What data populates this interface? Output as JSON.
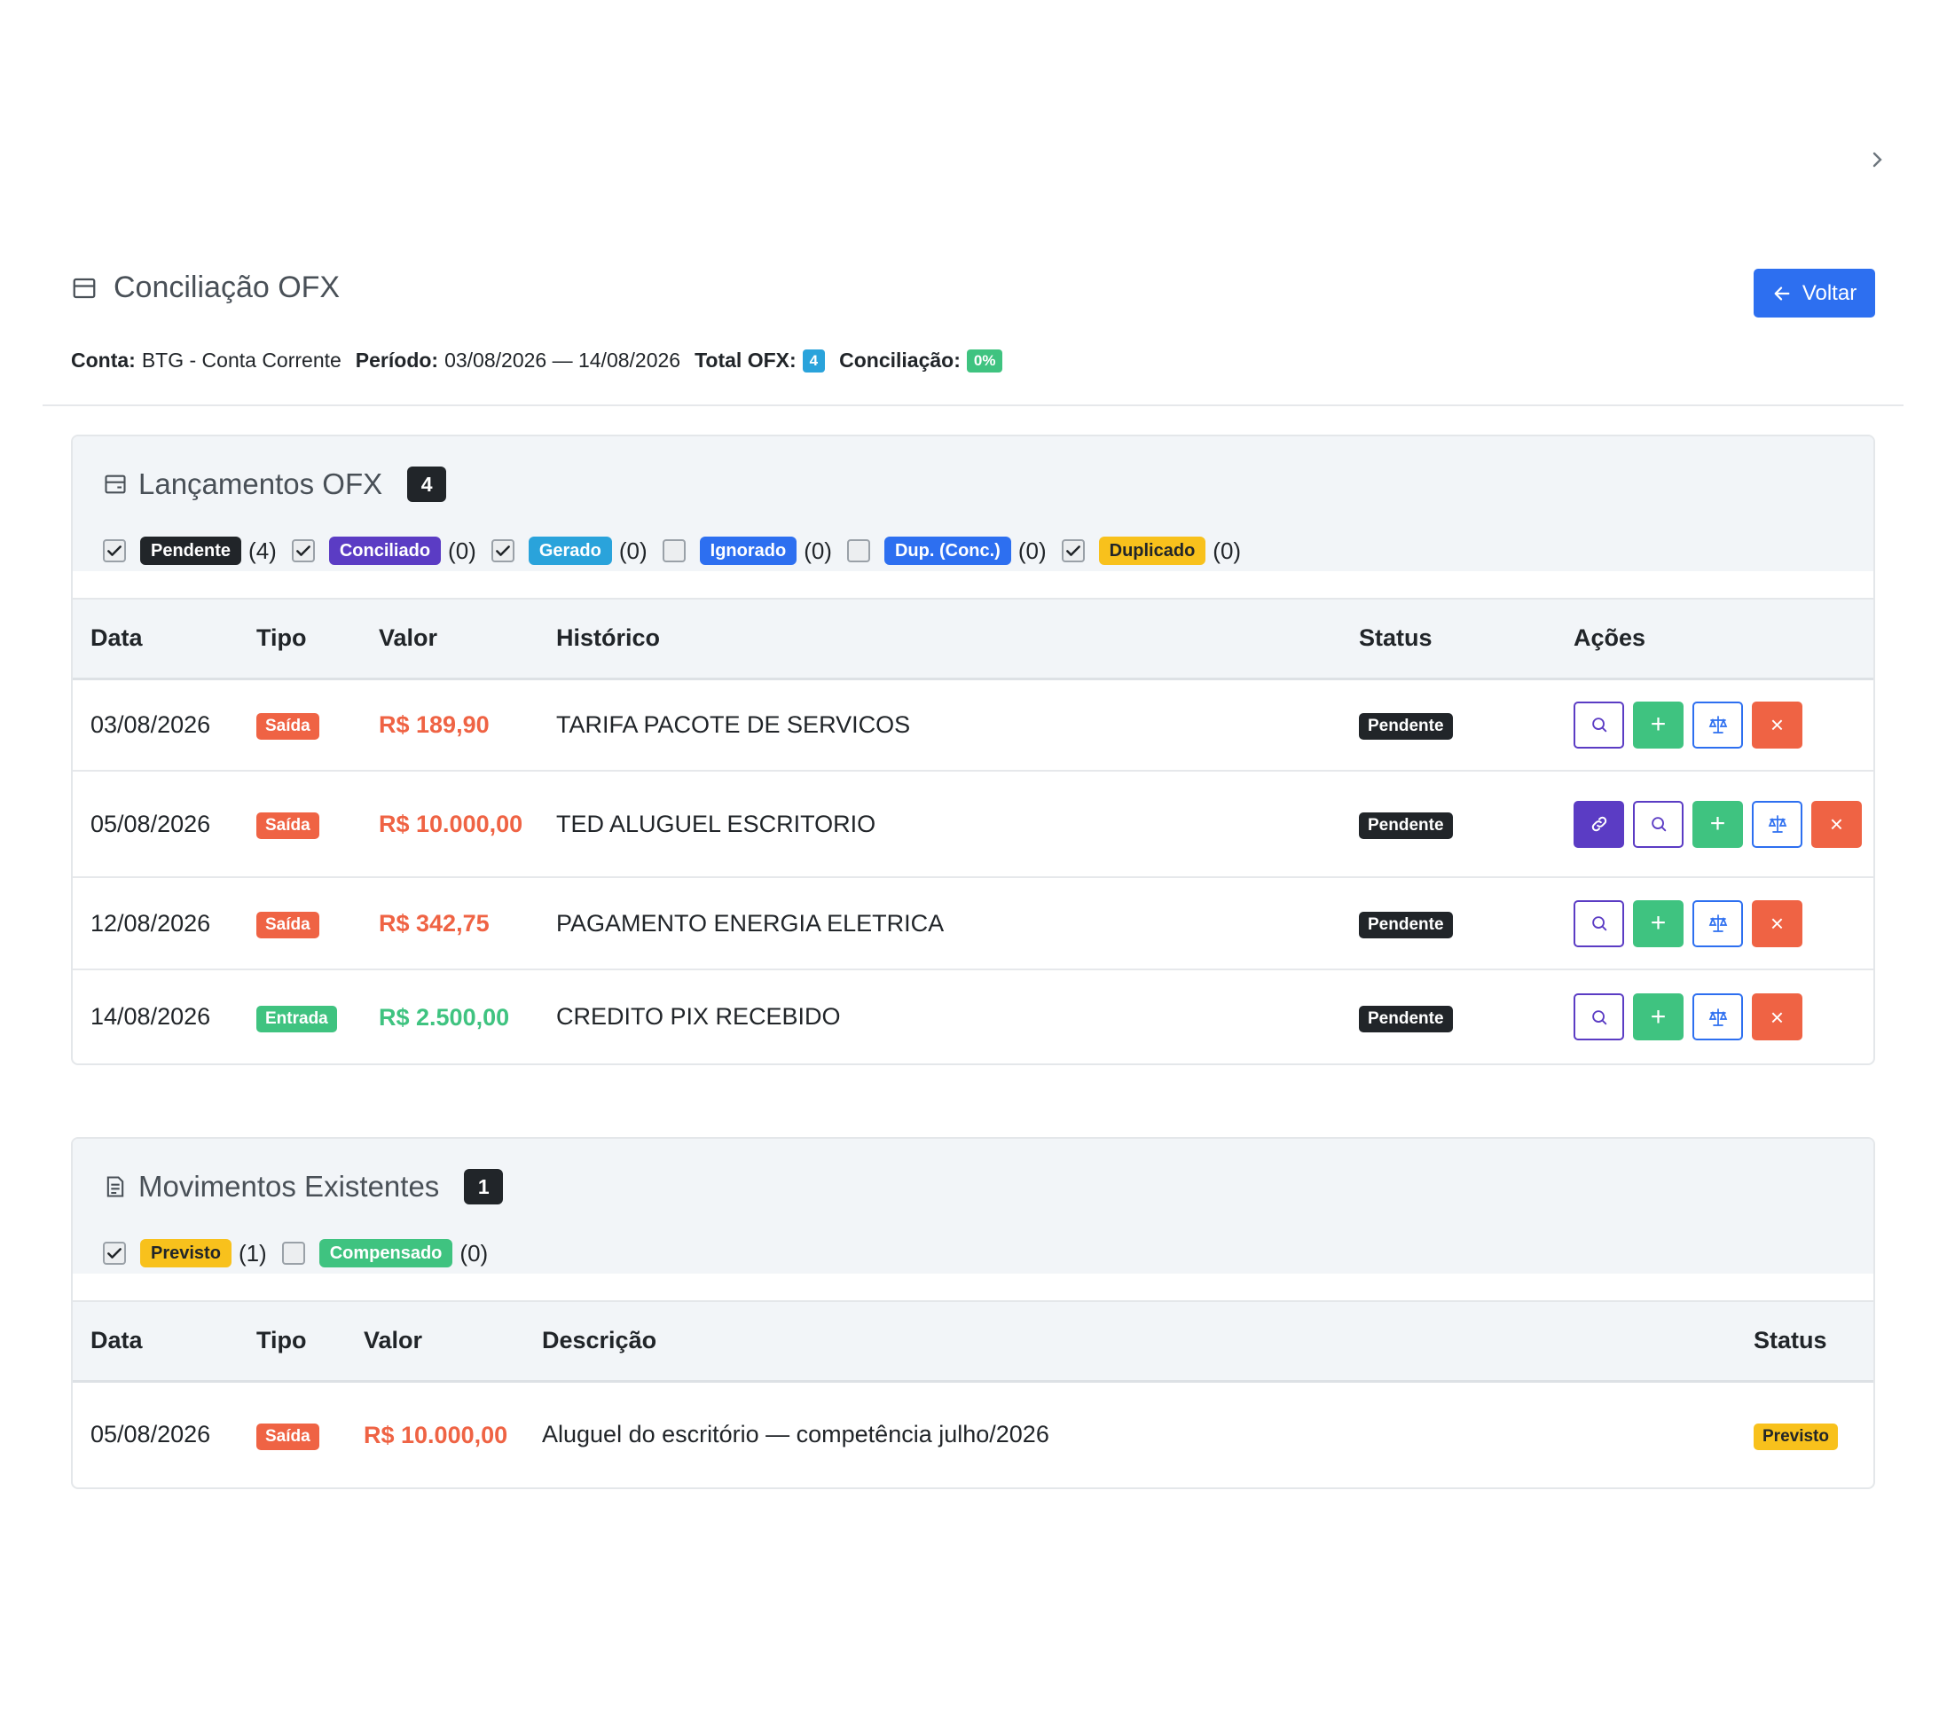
{
  "header": {
    "title": "Conciliação OFX",
    "back_label": "Voltar"
  },
  "summary": {
    "conta_label": "Conta:",
    "conta_value": "BTG - Conta Corrente",
    "periodo_label": "Período:",
    "periodo_value": "03/08/2026 — 14/08/2026",
    "total_label": "Total OFX:",
    "total_value": "4",
    "conc_label": "Conciliação:",
    "conc_value": "0%"
  },
  "ofx": {
    "title": "Lançamentos OFX",
    "count": "4",
    "filters": [
      {
        "label": "Pendente",
        "count": "(4)",
        "checked": true,
        "bg": "#212529",
        "fg": "#ffffff"
      },
      {
        "label": "Conciliado",
        "count": "(0)",
        "checked": true,
        "bg": "#5b3cc4",
        "fg": "#ffffff"
      },
      {
        "label": "Gerado",
        "count": "(0)",
        "checked": true,
        "bg": "#2aa3db",
        "fg": "#ffffff"
      },
      {
        "label": "Ignorado",
        "count": "(0)",
        "checked": false,
        "bg": "#2d6ff0",
        "fg": "#ffffff"
      },
      {
        "label": "Dup. (Conc.)",
        "count": "(0)",
        "checked": false,
        "bg": "#2d6ff0",
        "fg": "#ffffff"
      },
      {
        "label": "Duplicado",
        "count": "(0)",
        "checked": true,
        "bg": "#f8c11c",
        "fg": "#212529"
      }
    ],
    "columns": [
      "Data",
      "Tipo",
      "Valor",
      "Histórico",
      "Status",
      "Ações"
    ],
    "rows": [
      {
        "data": "03/08/2026",
        "tipo": "Saída",
        "valor": "R$ 189,90",
        "historico": "TARIFA PACOTE DE SERVICOS",
        "status": "Pendente",
        "link": false
      },
      {
        "data": "05/08/2026",
        "tipo": "Saída",
        "valor": "R$ 10.000,00",
        "historico": "TED ALUGUEL ESCRITORIO",
        "status": "Pendente",
        "link": true
      },
      {
        "data": "12/08/2026",
        "tipo": "Saída",
        "valor": "R$ 342,75",
        "historico": "PAGAMENTO ENERGIA ELETRICA",
        "status": "Pendente",
        "link": false
      },
      {
        "data": "14/08/2026",
        "tipo": "Entrada",
        "valor": "R$ 2.500,00",
        "historico": "CREDITO PIX RECEBIDO",
        "status": "Pendente",
        "link": false
      }
    ]
  },
  "mov": {
    "title": "Movimentos Existentes",
    "count": "1",
    "filters": [
      {
        "label": "Previsto",
        "count": "(1)",
        "checked": true,
        "bg": "#f8c11c",
        "fg": "#212529"
      },
      {
        "label": "Compensado",
        "count": "(0)",
        "checked": false,
        "bg": "#3fc380",
        "fg": "#ffffff"
      }
    ],
    "columns": [
      "Data",
      "Tipo",
      "Valor",
      "Descrição",
      "Status"
    ],
    "rows": [
      {
        "data": "05/08/2026",
        "tipo": "Saída",
        "valor": "R$ 10.000,00",
        "descricao": "Aluguel do escritório — competência julho/2026",
        "status": "Previsto"
      }
    ]
  },
  "colors": {
    "saida": "#ef6344",
    "entrada": "#3fc380",
    "primary": "#2d6ff0",
    "purple": "#5b3cc4",
    "conc_badge": "#3fc380",
    "total_badge": "#2aa3db"
  }
}
